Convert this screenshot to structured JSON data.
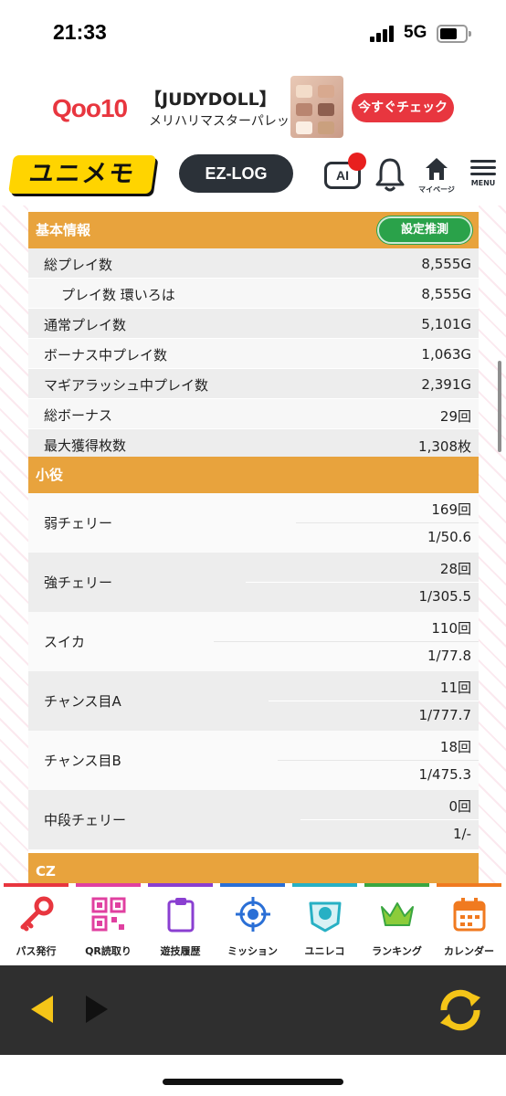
{
  "status_bar": {
    "time": "21:33",
    "network": "5G"
  },
  "ad": {
    "logo": "Qoo10",
    "brand": "【JUDYDOLL】",
    "subtitle": "メリハリマスターパレット",
    "cta": "今すぐチェック"
  },
  "header": {
    "logo_text": "ユニメモ",
    "ezlog_label": "EZ-LOG",
    "ai_label": "AI",
    "home_label": "マイページ",
    "menu_label": "MENU"
  },
  "basic_info": {
    "title": "基本情報",
    "estimate_button": "設定推測",
    "rows": [
      {
        "label": "総プレイ数",
        "value": "8,555G",
        "indent": false
      },
      {
        "label": "プレイ数 環いろは",
        "value": "8,555G",
        "indent": true
      },
      {
        "label": "通常プレイ数",
        "value": "5,101G",
        "indent": false
      },
      {
        "label": "ボーナス中プレイ数",
        "value": "1,063G",
        "indent": false
      },
      {
        "label": "マギアラッシュ中プレイ数",
        "value": "2,391G",
        "indent": false
      },
      {
        "label": "総ボーナス",
        "value": "29回",
        "indent": false
      },
      {
        "label": "最大獲得枚数",
        "value": "1,308枚",
        "indent": false
      }
    ]
  },
  "koyaku": {
    "title": "小役",
    "rows": [
      {
        "label": "弱チェリー",
        "count": "169回",
        "prob": "1/50.6"
      },
      {
        "label": "強チェリー",
        "count": "28回",
        "prob": "1/305.5"
      },
      {
        "label": "スイカ",
        "count": "110回",
        "prob": "1/77.8"
      },
      {
        "label": "チャンス目A",
        "count": "11回",
        "prob": "1/777.7"
      },
      {
        "label": "チャンス目B",
        "count": "18回",
        "prob": "1/475.3"
      },
      {
        "label": "中段チェリー",
        "count": "0回",
        "prob": "1/-"
      }
    ]
  },
  "cz": {
    "title": "CZ"
  },
  "bottom_nav": {
    "items": [
      {
        "label": "パス発行",
        "icon": "key-icon",
        "color": "#e8363f"
      },
      {
        "label": "QR読取り",
        "icon": "qr-icon",
        "color": "#e040a0"
      },
      {
        "label": "遊技履歴",
        "icon": "clipboard-icon",
        "color": "#8a3fd1"
      },
      {
        "label": "ミッション",
        "icon": "target-icon",
        "color": "#2a6fd6"
      },
      {
        "label": "ユニレコ",
        "icon": "unireco-icon",
        "color": "#27b0c4"
      },
      {
        "label": "ランキング",
        "icon": "crown-icon",
        "color": "#3aa640"
      },
      {
        "label": "カレンダー",
        "icon": "calendar-icon",
        "color": "#f07a20"
      }
    ]
  },
  "colors": {
    "section_header": "#e8a33d",
    "estimate_button": "#2aa24a",
    "browser_toolbar": "#2f2f2f",
    "arrow_yellow": "#f5c518"
  }
}
